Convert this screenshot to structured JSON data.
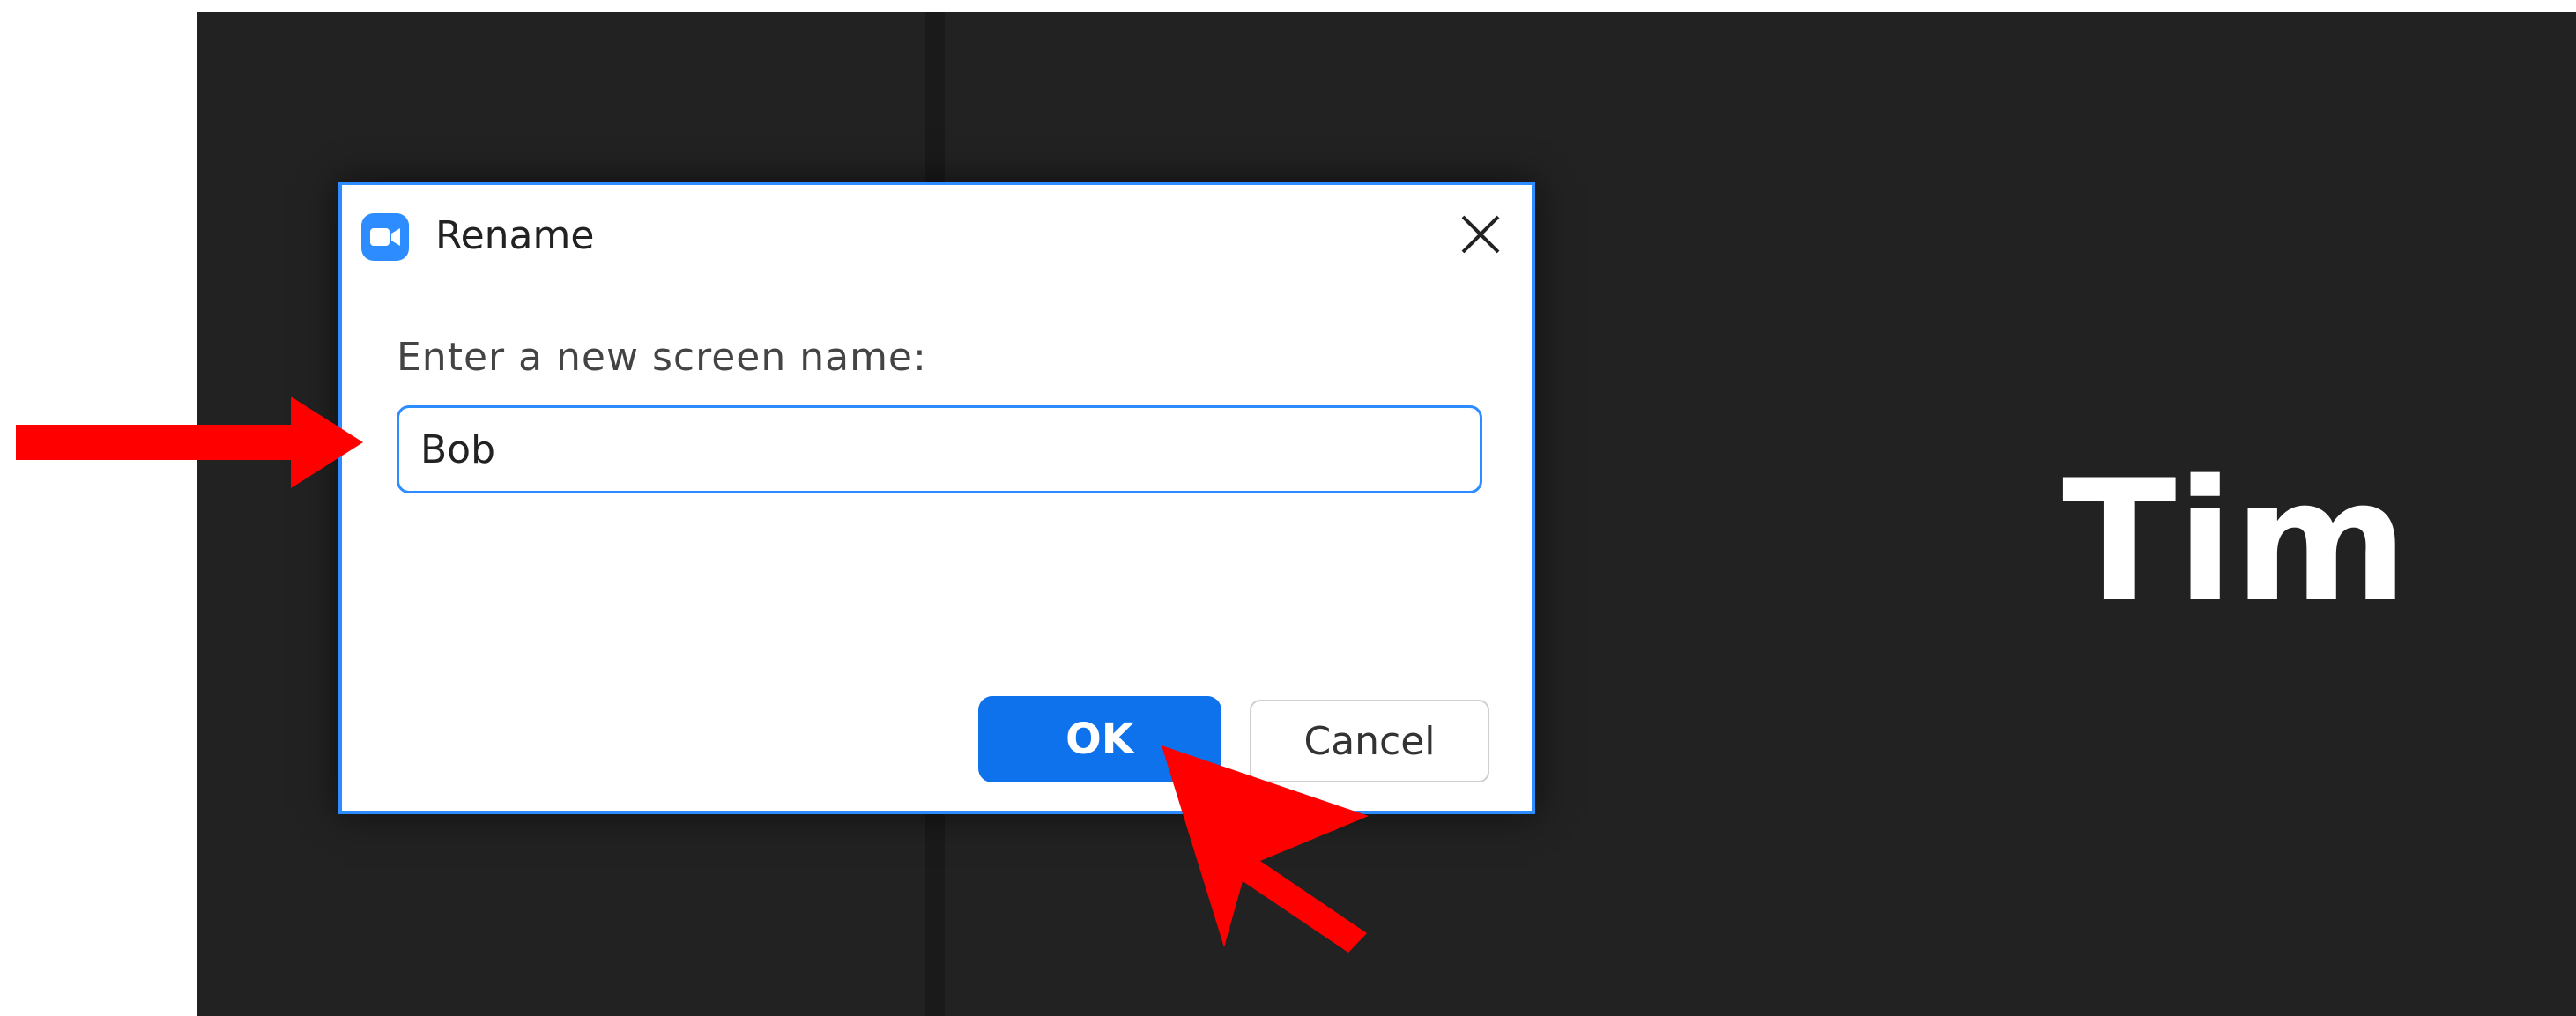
{
  "meeting": {
    "participant_name": "Tim"
  },
  "dialog": {
    "title": "Rename",
    "prompt": "Enter a new screen name:",
    "input_value": "Bob",
    "ok_label": "OK",
    "cancel_label": "Cancel",
    "icons": {
      "app": "zoom-camera-icon",
      "close": "close-icon"
    }
  },
  "annotations": {
    "color": "#ff0000",
    "items": [
      "arrow-pointing-to-input",
      "cursor-arrow-pointing-to-ok"
    ]
  },
  "colors": {
    "accent": "#2d8cff",
    "ok_button": "#0e72ed",
    "meeting_background": "#222222"
  }
}
